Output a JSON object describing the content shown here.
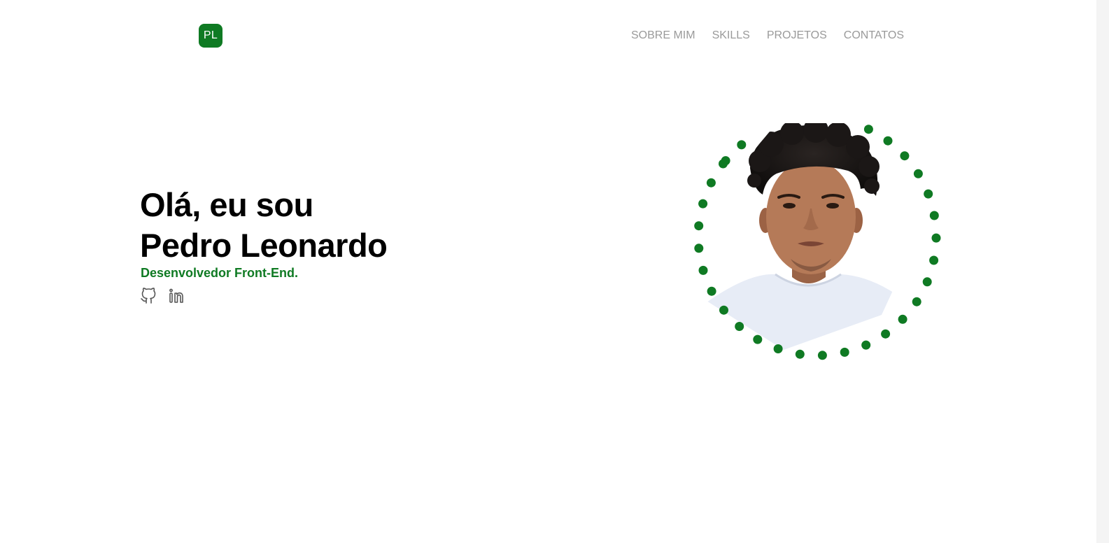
{
  "header": {
    "logo_text": "PL",
    "nav": [
      {
        "label": "SOBRE MIM"
      },
      {
        "label": "SKILLS"
      },
      {
        "label": "PROJETOS"
      },
      {
        "label": "CONTATOS"
      }
    ]
  },
  "hero": {
    "title_line1": "Olá, eu sou",
    "title_line2": "Pedro Leonardo",
    "subtitle": "Desenvolvedor Front-End.",
    "socials": [
      {
        "icon": "github-icon"
      },
      {
        "icon": "linkedin-icon"
      }
    ]
  },
  "colors": {
    "accent": "#0f7a23",
    "nav_text": "#9a9a9a",
    "title_text": "#000000",
    "icon_stroke": "#555555"
  }
}
